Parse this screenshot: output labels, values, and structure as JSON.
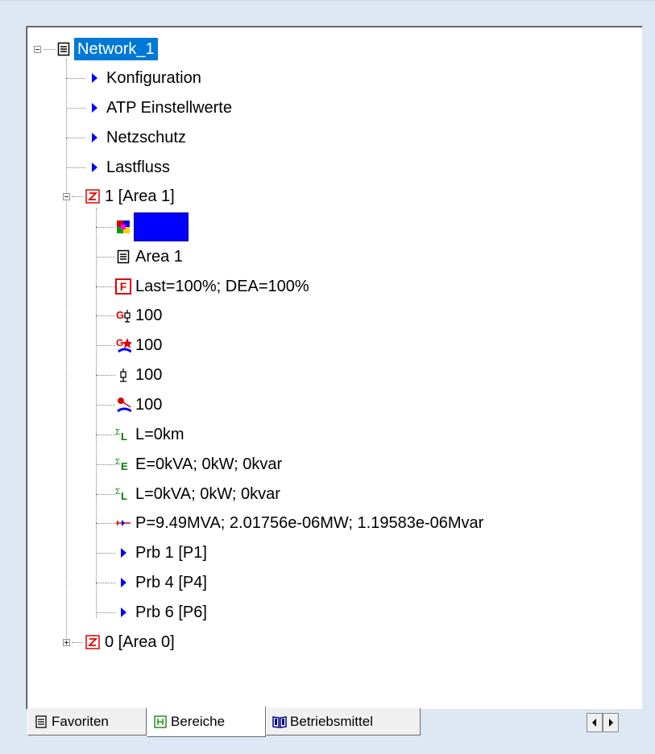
{
  "tree": {
    "root_label": "Network_1",
    "root_children": [
      "Konfiguration",
      "ATP Einstellwerte",
      "Netzschutz",
      "Lastfluss"
    ],
    "area1": {
      "label": "1 [Area 1]",
      "color_swatch": "#0000ff",
      "doc_label": "Area 1",
      "f_label": "Last=100%; DEA=100%",
      "gen_label": "100",
      "gen2_label": "100",
      "load_label": "100",
      "load2_label": "100",
      "sum_l_km": "L=0km",
      "sum_e": "E=0kVA; 0kW; 0kvar",
      "sum_l": "L=0kVA; 0kW; 0kvar",
      "p_label": "P=9.49MVA; 2.01756e-06MW; 1.19583e-06Mvar",
      "prb": [
        "Prb 1 [P1]",
        "Prb 4 [P4]",
        "Prb 6 [P6]"
      ]
    },
    "area0": {
      "label": "0 [Area 0]"
    }
  },
  "tabs": {
    "favoriten": "Favoriten",
    "bereiche": "Bereiche",
    "betriebsmittel": "Betriebsmittel"
  },
  "icons": {
    "doc": "document-icon",
    "arrow": "blue-triangle-arrow-icon",
    "area": "area-z-icon",
    "color": "color-palette-icon",
    "f": "f-box-icon",
    "gen": "generator-icon",
    "gen2": "generator-star-icon",
    "load": "load-icon",
    "load2": "load-star-icon",
    "sum_l": "sigma-l-icon",
    "sum_e": "sigma-e-icon",
    "power": "power-arrow-icon",
    "book": "book-icon",
    "grid": "grid-icon"
  },
  "colors": {
    "selection": "#0078d7",
    "arrow_blue": "#0000ff",
    "area_red": "#e00000",
    "sigma_green": "#008000"
  }
}
